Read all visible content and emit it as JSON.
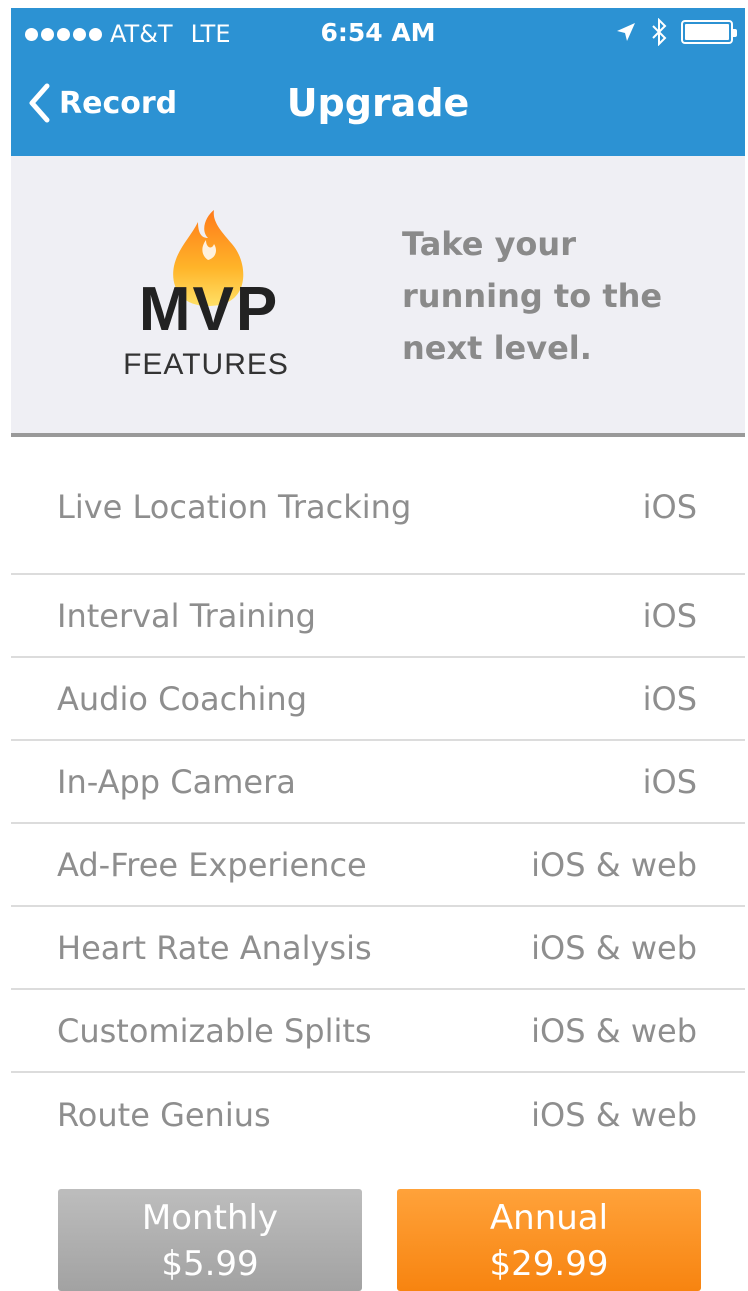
{
  "status_bar": {
    "carrier": "AT&T",
    "network": "LTE",
    "time": "6:54 AM"
  },
  "nav": {
    "back_label": "Record",
    "title": "Upgrade"
  },
  "promo": {
    "logo_top": "MVP",
    "logo_bottom": "FEATURES",
    "tagline": "Take your running to the next level."
  },
  "features": [
    {
      "name": "Live Location Tracking",
      "platform": "iOS"
    },
    {
      "name": "Interval Training",
      "platform": "iOS"
    },
    {
      "name": "Audio Coaching",
      "platform": "iOS"
    },
    {
      "name": "In-App Camera",
      "platform": "iOS"
    },
    {
      "name": "Ad-Free Experience",
      "platform": "iOS & web"
    },
    {
      "name": "Heart Rate Analysis",
      "platform": "iOS & web"
    },
    {
      "name": "Customizable Splits",
      "platform": "iOS & web"
    },
    {
      "name": "Route Genius",
      "platform": "iOS & web"
    }
  ],
  "plans": {
    "monthly": {
      "label": "Monthly",
      "price": "$5.99"
    },
    "annual": {
      "label": "Annual",
      "price": "$29.99"
    }
  },
  "colors": {
    "header_blue": "#2c92d3",
    "annual_orange": "#f78f1e",
    "monthly_gray": "#b0b0b0"
  },
  "icons": [
    "signal-dots-icon",
    "location-arrow-icon",
    "bluetooth-icon",
    "battery-icon",
    "back-chevron-icon",
    "flame-icon"
  ]
}
